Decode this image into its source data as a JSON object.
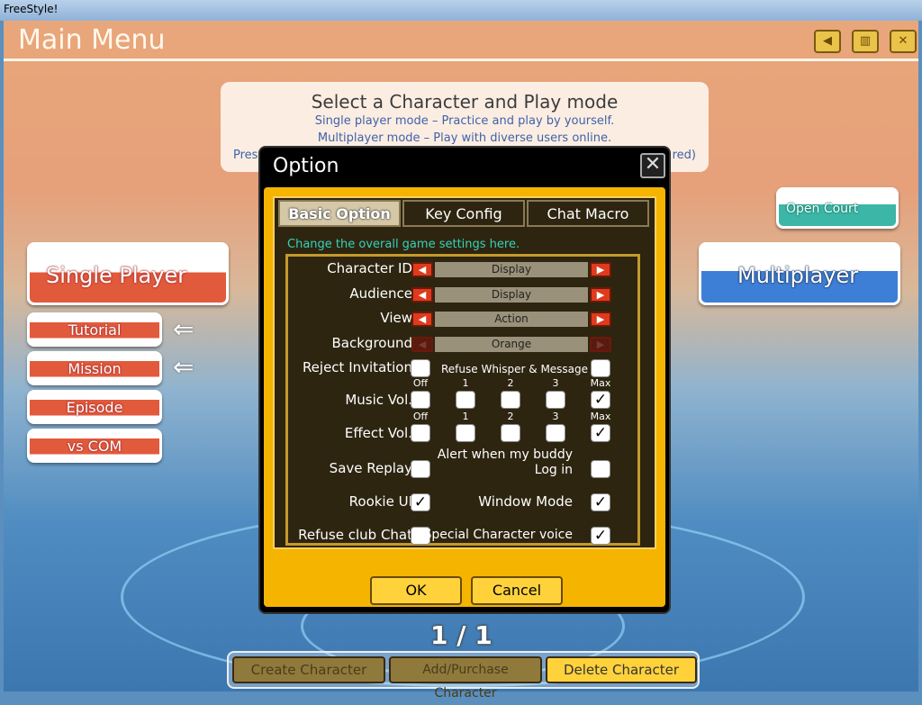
{
  "window": {
    "title": "FreeStyle!"
  },
  "header": {
    "title": "Main Menu",
    "icons": [
      "back-icon",
      "book-icon",
      "close-game-icon"
    ]
  },
  "info": {
    "heading": "Select a Character and Play mode",
    "line1": "Single player mode – Practice and play by yourself.",
    "line2": "Multiplayer mode – Play with diverse users online.",
    "line3_left": "Pres",
    "line3_right": "red)"
  },
  "left_menu": {
    "single_player": "Single Player",
    "items": [
      "Tutorial",
      "Mission",
      "Episode",
      "vs COM"
    ]
  },
  "right_menu": {
    "open_court": "Open Court",
    "multiplayer": "Multiplayer"
  },
  "dialog": {
    "title": "Option",
    "tabs": [
      {
        "label": "Basic Option",
        "active": true
      },
      {
        "label": "Key Config",
        "active": false
      },
      {
        "label": "Chat Macro",
        "active": false
      }
    ],
    "description": "Change the overall game settings here.",
    "selectors": [
      {
        "label": "Character ID",
        "value": "Display",
        "enabled": true
      },
      {
        "label": "Audience",
        "value": "Display",
        "enabled": true
      },
      {
        "label": "View",
        "value": "Action",
        "enabled": true
      },
      {
        "label": "Background",
        "value": "Orange",
        "enabled": false
      }
    ],
    "reject_invitation": {
      "label": "Reject Invitation",
      "checked": false
    },
    "refuse_whisper": {
      "label": "Refuse Whisper & Message",
      "checked": false
    },
    "volume_levels": [
      "Off",
      "1",
      "2",
      "3",
      "Max"
    ],
    "music_vol": {
      "label": "Music Vol.",
      "selected": "Max"
    },
    "effect_vol": {
      "label": "Effect Vol.",
      "selected": "Max"
    },
    "save_replay": {
      "label": "Save Replay",
      "checked": false
    },
    "buddy_alert": {
      "label_line1": "Alert when my buddy",
      "label_line2": "Log in",
      "checked": false
    },
    "rookie_ui": {
      "label": "Rookie UI",
      "checked": true
    },
    "window_mode": {
      "label": "Window Mode",
      "checked": true
    },
    "refuse_club_chat": {
      "label": "Refuse club Chat",
      "checked": false
    },
    "special_voice": {
      "label": "Special Character voice",
      "checked": true
    },
    "ok": "OK",
    "cancel": "Cancel"
  },
  "pager": "1 / 1",
  "bottom": {
    "create": "Create Character",
    "add": "Add/Purchase Character",
    "delete": "Delete Character"
  }
}
